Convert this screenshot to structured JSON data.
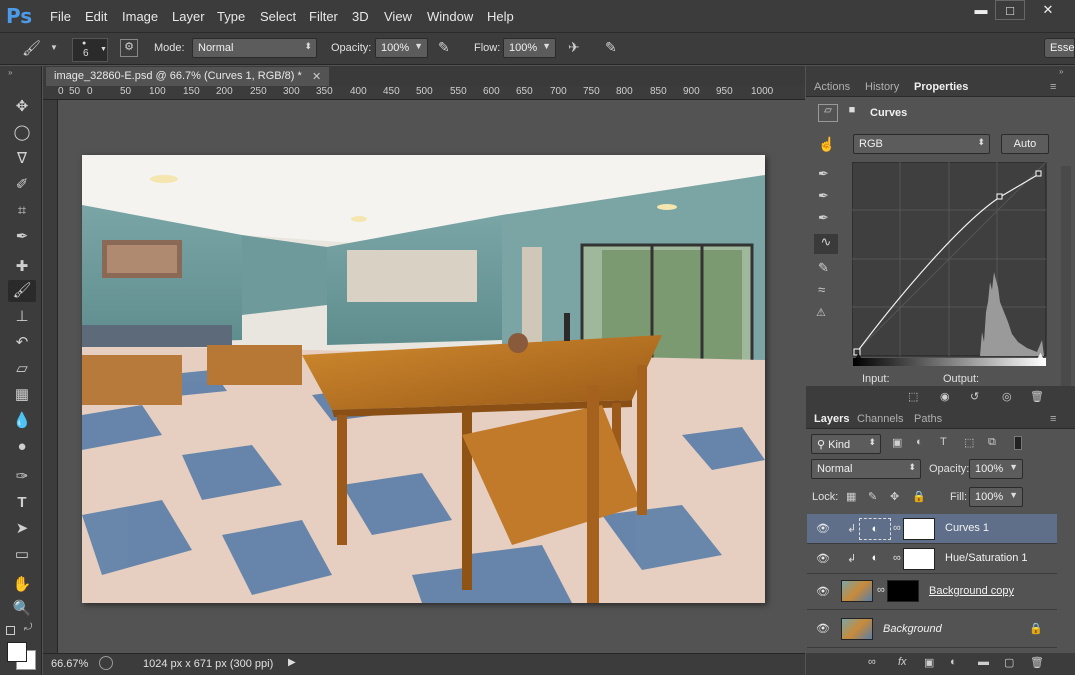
{
  "app": {
    "logo": "Ps"
  },
  "menu": [
    "File",
    "Edit",
    "Image",
    "Layer",
    "Type",
    "Select",
    "Filter",
    "3D",
    "View",
    "Window",
    "Help"
  ],
  "window_controls": {
    "minimize": "▬",
    "maximize": "□",
    "close": "✕"
  },
  "options_bar": {
    "brush_size": "6",
    "mode_label": "Mode:",
    "mode_value": "Normal",
    "opacity_label": "Opacity:",
    "opacity_value": "100%",
    "flow_label": "Flow:",
    "flow_value": "100%",
    "workspace": "Esse"
  },
  "document": {
    "tab_title": "image_32860-E.psd @ 66.7% (Curves 1, RGB/8) *",
    "zoom": "66.67%",
    "info": "1024 px x 671 px (300 ppi)"
  },
  "ruler": [
    "0",
    "50",
    "0",
    "50",
    "100",
    "150",
    "200",
    "250",
    "300",
    "350",
    "400",
    "450",
    "500",
    "550",
    "600",
    "650",
    "700",
    "750",
    "800",
    "850",
    "900",
    "950",
    "1000"
  ],
  "properties_panel": {
    "tabs": [
      "Actions",
      "History",
      "Properties"
    ],
    "active_tab": "Properties",
    "title": "Curves",
    "channel": "RGB",
    "auto_label": "Auto",
    "input_label": "Input:",
    "output_label": "Output:"
  },
  "layers_panel": {
    "tabs": [
      "Layers",
      "Channels",
      "Paths"
    ],
    "active_tab": "Layers",
    "filter_kind": "Kind",
    "blend_mode": "Normal",
    "opacity_label": "Opacity:",
    "opacity_value": "100%",
    "lock_label": "Lock:",
    "fill_label": "Fill:",
    "fill_value": "100%",
    "layers": [
      {
        "name": "Curves 1",
        "selected": true
      },
      {
        "name": "Hue/Saturation 1",
        "selected": false
      },
      {
        "name": "Background copy",
        "selected": false
      },
      {
        "name": "Background",
        "selected": false
      }
    ]
  },
  "colors": {
    "accent": "#4c9be8",
    "selected_layer": "#5f6f89"
  }
}
